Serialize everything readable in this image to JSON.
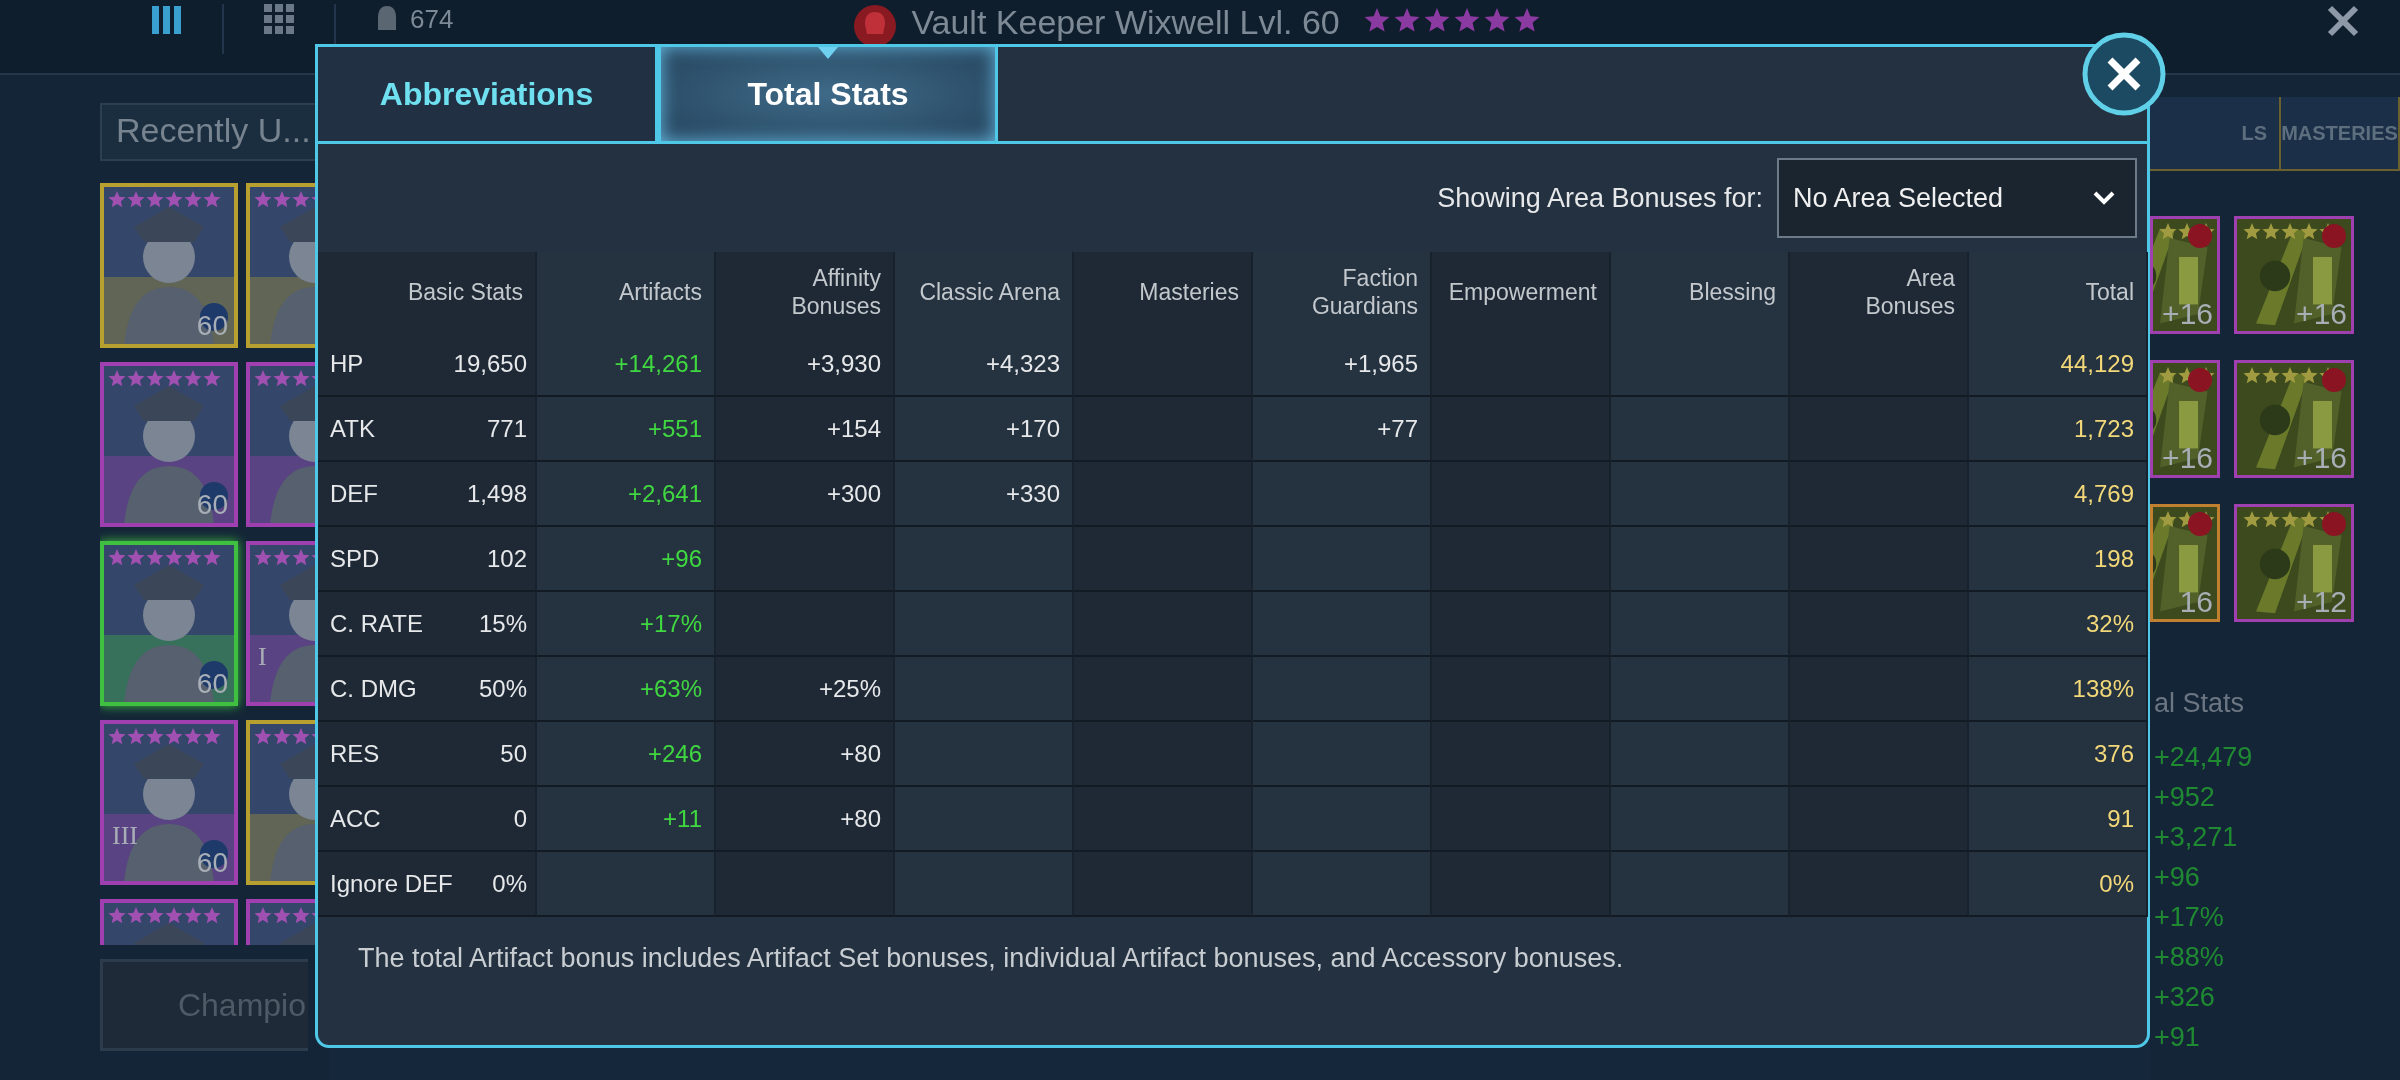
{
  "top_bar": {
    "count": "674",
    "title": "Vault Keeper Wixwell Lvl. 60",
    "stars": 6
  },
  "champion_panel": {
    "filter": "Recently U...",
    "button": "Champio",
    "champions": [
      {
        "color": "#b8a030",
        "level": "60",
        "selected": false
      },
      {
        "color": "#b8a030",
        "selected": false
      },
      {
        "color": "#a040b0",
        "level": "60",
        "selected": false
      },
      {
        "color": "#a040b0",
        "selected": false
      },
      {
        "color": "#40c040",
        "level": "60",
        "selected": true
      },
      {
        "color": "#a040b0",
        "rank": "I",
        "selected": false
      },
      {
        "color": "#a040b0",
        "rank": "III",
        "level": "60",
        "selected": false
      },
      {
        "color": "#b8a030",
        "selected": false
      },
      {
        "color": "#a040b0",
        "selected": false
      },
      {
        "color": "#a040b0",
        "selected": false
      }
    ]
  },
  "gear_panel": {
    "tabs": [
      {
        "label": "LS",
        "selected": false
      },
      {
        "label": "MASTERIES",
        "selected": false
      }
    ],
    "artifacts": [
      {
        "level": "+16",
        "color": "#a040b0"
      },
      {
        "level": "+16",
        "color": "#a040b0"
      },
      {
        "level": "+16",
        "color": "#a040b0"
      },
      {
        "level": "+16",
        "color": "#a040b0"
      },
      {
        "level": "16",
        "color": "#c08030"
      },
      {
        "level": "+12",
        "color": "#a040b0"
      }
    ],
    "stats_title": "al Stats",
    "stats": [
      "+24,479",
      "+952",
      "+3,271",
      "+96",
      "+17%",
      "+88%",
      "+326",
      "+91"
    ]
  },
  "modal": {
    "tabs": [
      {
        "label": "Abbreviations",
        "selected": false
      },
      {
        "label": "Total Stats",
        "selected": true
      }
    ],
    "area_filter": {
      "label": "Showing Area Bonuses for:",
      "value": "No Area Selected"
    },
    "columns": [
      "Basic Stats",
      "Artifacts",
      "Affinity Bonuses",
      "Classic Arena",
      "Masteries",
      "Faction Guardians",
      "Empowerment",
      "Blessing",
      "Area Bonuses",
      "Total"
    ],
    "rows": [
      {
        "stat": "HP",
        "basic_stats": "19,650",
        "artifacts": "+14,261",
        "affinity_bonuses": "+3,930",
        "classic_arena": "+4,323",
        "faction_guardians": "+1,965",
        "total": "44,129"
      },
      {
        "stat": "ATK",
        "basic_stats": "771",
        "artifacts": "+551",
        "affinity_bonuses": "+154",
        "classic_arena": "+170",
        "faction_guardians": "+77",
        "total": "1,723"
      },
      {
        "stat": "DEF",
        "basic_stats": "1,498",
        "artifacts": "+2,641",
        "affinity_bonuses": "+300",
        "classic_arena": "+330",
        "total": "4,769"
      },
      {
        "stat": "SPD",
        "basic_stats": "102",
        "artifacts": "+96",
        "total": "198"
      },
      {
        "stat": "C. RATE",
        "basic_stats": "15%",
        "artifacts": "+17%",
        "total": "32%"
      },
      {
        "stat": "C. DMG",
        "basic_stats": "50%",
        "artifacts": "+63%",
        "affinity_bonuses": "+25%",
        "total": "138%"
      },
      {
        "stat": "RES",
        "basic_stats": "50",
        "artifacts": "+246",
        "affinity_bonuses": "+80",
        "total": "376"
      },
      {
        "stat": "ACC",
        "basic_stats": "0",
        "artifacts": "+11",
        "affinity_bonuses": "+80",
        "total": "91"
      },
      {
        "stat": "Ignore DEF",
        "basic_stats": "0%",
        "total": "0%"
      }
    ],
    "footnote": "The total Artifact bonus includes Artifact Set bonuses, individual Artifact bonuses, and Accessory bonuses."
  }
}
